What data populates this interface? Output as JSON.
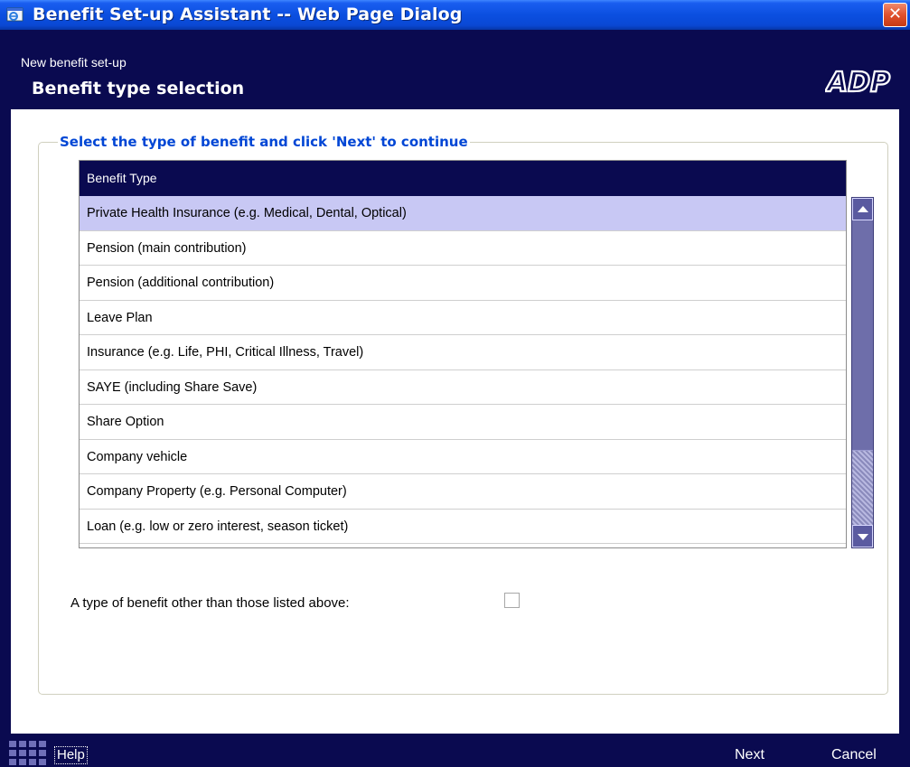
{
  "window": {
    "title": "Benefit Set-up Assistant -- Web Page Dialog",
    "close_glyph": "✕"
  },
  "header": {
    "subtitle": "New benefit set-up",
    "title": "Benefit type selection",
    "logo_text": "ADP"
  },
  "section": {
    "legend": "Select the type of benefit and click 'Next' to continue"
  },
  "grid": {
    "column_header": "Benefit Type",
    "rows": [
      "Private Health Insurance (e.g. Medical, Dental, Optical)",
      "Pension (main contribution)",
      "Pension (additional contribution)",
      "Leave Plan",
      "Insurance (e.g. Life, PHI, Critical Illness, Travel)",
      "SAYE (including Share Save)",
      "Share Option",
      "Company vehicle",
      "Company Property (e.g. Personal Computer)",
      "Loan (e.g. low or zero interest, season ticket)"
    ],
    "selected_index": 0
  },
  "other_benefit": {
    "label": "A type of benefit other than those listed above:",
    "checked": false
  },
  "footer": {
    "help_label": "Help",
    "next_label": "Next",
    "cancel_label": "Cancel"
  },
  "colors": {
    "titlebar": "#0a48d4",
    "dark_band": "#0a0a50",
    "legend_text": "#0046d5",
    "selected_row": "#c8c8f4",
    "close_button": "#e0502c"
  },
  "icons": [
    "ie-window-icon",
    "close-icon",
    "adp-logo",
    "scroll-up-icon",
    "scroll-down-icon",
    "grip-icon"
  ]
}
